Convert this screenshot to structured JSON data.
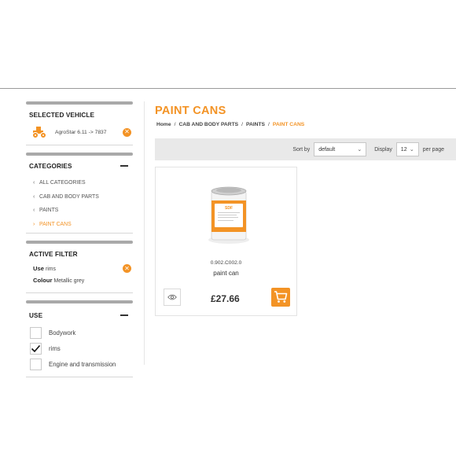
{
  "sidebar": {
    "selected_vehicle": {
      "title": "SELECTED VEHICLE",
      "vehicle_name": "AgroStar 6.11 -> 7837",
      "icon": "tractor-icon"
    },
    "categories": {
      "title": "CATEGORIES",
      "items": [
        {
          "label": "ALL CATEGORIES",
          "chevron": "‹"
        },
        {
          "label": "CAB AND BODY PARTS",
          "chevron": "‹"
        },
        {
          "label": "PAINTS",
          "chevron": "‹"
        },
        {
          "label": "PAINT CANS",
          "chevron": "›",
          "active": true
        }
      ]
    },
    "active_filter": {
      "title": "ACTIVE FILTER",
      "filters": [
        {
          "key": "Use",
          "value": "rims"
        },
        {
          "key": "Colour",
          "value": "Metallic grey"
        }
      ]
    },
    "use": {
      "title": "USE",
      "options": [
        {
          "label": "Bodywork",
          "checked": false
        },
        {
          "label": "rims",
          "checked": true
        },
        {
          "label": "Engine and transmission",
          "checked": false
        }
      ]
    }
  },
  "main": {
    "title": "PAINT CANS",
    "breadcrumb": [
      {
        "label": "Home"
      },
      {
        "label": "CAB AND BODY PARTS"
      },
      {
        "label": "PAINTS"
      },
      {
        "label": "PAINT CANS",
        "current": true
      }
    ],
    "breadcrumb_separator": "/",
    "toolbar": {
      "sort_label": "Sort by",
      "sort_value": "default",
      "display_label": "Display",
      "display_value": "12",
      "per_page_label": "per page"
    },
    "products": [
      {
        "sku": "0.902.C002.0",
        "name": "paint can",
        "price": "£27.66",
        "can_brand": "SDF"
      }
    ]
  },
  "colors": {
    "accent": "#f39325",
    "toolbar_bg": "#e9e9e9",
    "panel_bar": "#a9a9a9"
  }
}
